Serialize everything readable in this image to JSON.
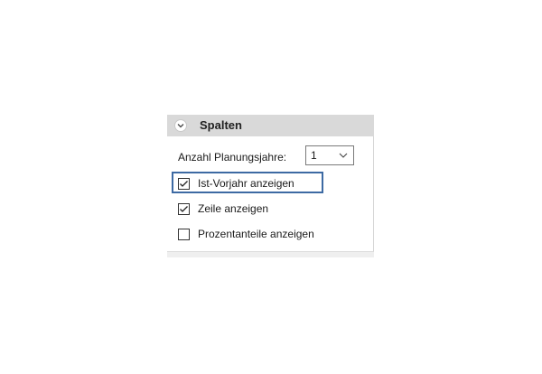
{
  "panel": {
    "title": "Spalten",
    "collapse_icon": "chevron-down-circle-icon",
    "planning_years": {
      "label": "Anzahl Planungsjahre:",
      "selected": "1",
      "dropdown_icon": "chevron-down-icon"
    },
    "options": [
      {
        "label": "Ist-Vorjahr anzeigen",
        "checked": true,
        "highlighted": true
      },
      {
        "label": "Zeile anzeigen",
        "checked": true,
        "highlighted": false
      },
      {
        "label": "Prozentanteile anzeigen",
        "checked": false,
        "highlighted": false
      }
    ]
  },
  "colors": {
    "header_bg": "#d9d9d9",
    "highlight_border": "#3d6aa3"
  }
}
